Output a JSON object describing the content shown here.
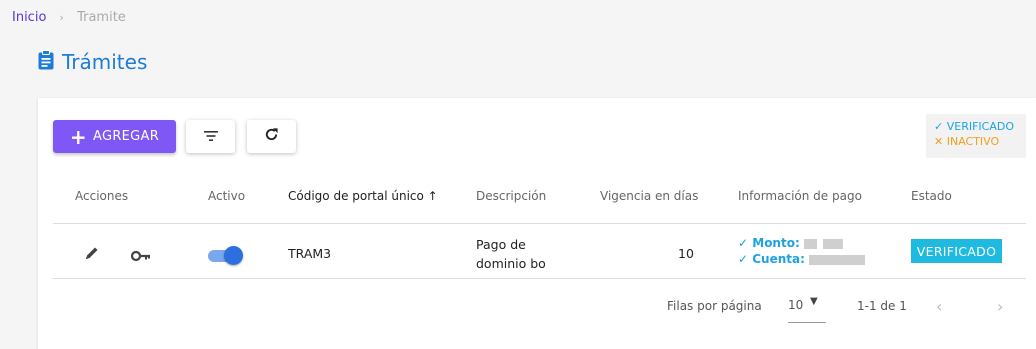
{
  "breadcrumb": {
    "home": "Inicio",
    "separator": "›",
    "current": "Tramite"
  },
  "page": {
    "title": "Trámites",
    "title_icon": "clipboard-icon"
  },
  "toolbar": {
    "add_label": "AGREGAR",
    "add_icon": "plus-icon",
    "filter_icon": "filter-icon",
    "refresh_icon": "refresh-icon"
  },
  "legend": {
    "verified_mark": "✓",
    "verified": "VERIFICADO",
    "inactive_mark": "✕",
    "inactive": "INACTIVO"
  },
  "table": {
    "headers": [
      "Acciones",
      "Activo",
      "Código de portal único",
      "Descripción",
      "Vigencia en días",
      "Información de pago",
      "Estado"
    ],
    "sort_indicator": "↑",
    "rows": [
      {
        "active": true,
        "code": "TRAM3",
        "description_line1": "Pago de",
        "description_line2": "dominio bo",
        "validity_days": "10",
        "payment": {
          "mark": "✓",
          "monto_label": "Monto:",
          "cuenta_label": "Cuenta:"
        },
        "status": "VERIFICADO"
      }
    ]
  },
  "pagination": {
    "rows_per_page_label": "Filas por página",
    "rows_per_page": "10",
    "range": "1-1 de 1",
    "prev": "‹",
    "next": "›"
  },
  "colors": {
    "primary": "#7e57f5",
    "link": "#5c35d9",
    "title": "#1e7bd6",
    "verified": "#1ea3e0",
    "inactive": "#f0a020",
    "badge": "#1ebae0"
  }
}
